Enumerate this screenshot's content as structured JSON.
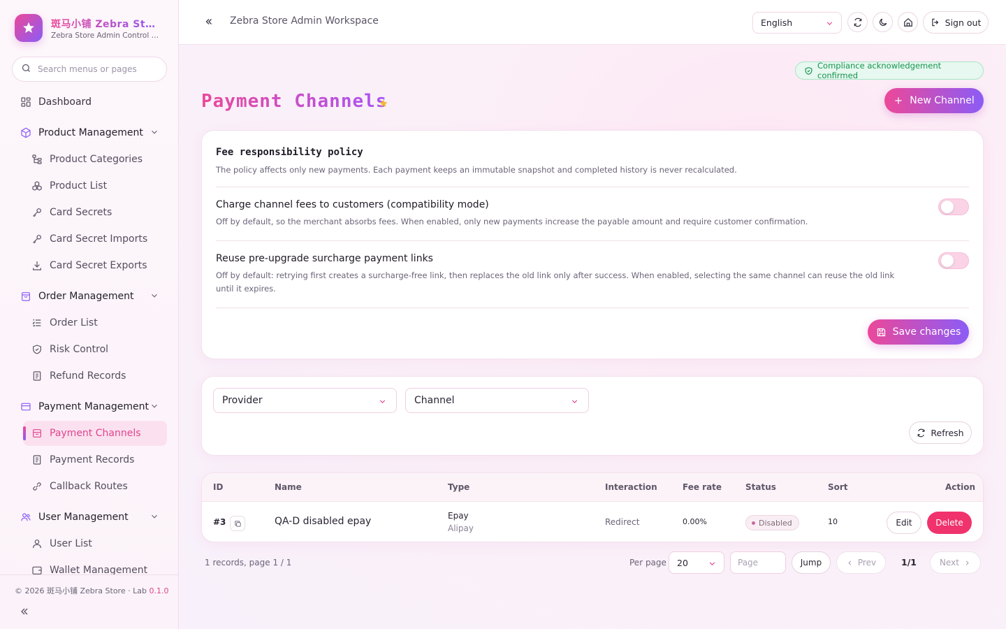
{
  "brand": {
    "title": "斑马小铺 Zebra St…",
    "subtitle": "Zebra Store Admin Control P…"
  },
  "sidebar": {
    "search_placeholder": "Search menus or pages",
    "dashboard": "Dashboard",
    "groups": {
      "product": "Product Management",
      "order": "Order Management",
      "payment": "Payment Management",
      "user": "User Management"
    },
    "items": {
      "product_categories": "Product Categories",
      "product_list": "Product List",
      "card_secrets": "Card Secrets",
      "card_secret_imports": "Card Secret Imports",
      "card_secret_exports": "Card Secret Exports",
      "order_list": "Order List",
      "risk_control": "Risk Control",
      "refund_records": "Refund Records",
      "payment_channels": "Payment Channels",
      "payment_records": "Payment Records",
      "callback_routes": "Callback Routes",
      "user_list": "User List",
      "wallet_management": "Wallet Management"
    },
    "footer": {
      "copyright": "© 2026 斑马小铺 Zebra Store · Lab ",
      "version": "0.1.0"
    }
  },
  "header": {
    "workspace_title": "Zebra Store Admin Workspace",
    "language": "English",
    "sign_out": "Sign out"
  },
  "page": {
    "compliance_badge": "Compliance acknowledgement confirmed",
    "title": "Payment Channels",
    "new_channel": "New Channel"
  },
  "fee_policy": {
    "title": "Fee responsibility policy",
    "description": "The policy affects only new payments. Each payment keeps an immutable snapshot and completed history is never recalculated.",
    "options": [
      {
        "title": "Charge channel fees to customers (compatibility mode)",
        "description": "Off by default, so the merchant absorbs fees. When enabled, only new payments increase the payable amount and require customer confirmation.",
        "enabled": false
      },
      {
        "title": "Reuse pre-upgrade surcharge payment links",
        "description": "Off by default: retrying first creates a surcharge-free link, then replaces the old link only after success. When enabled, selecting the same channel can reuse the old link until it expires.",
        "enabled": false
      }
    ],
    "save_label": "Save changes"
  },
  "filters": {
    "provider": "Provider",
    "channel": "Channel",
    "refresh": "Refresh"
  },
  "table": {
    "columns": [
      "ID",
      "Name",
      "Type",
      "Interaction",
      "Fee rate",
      "Status",
      "Sort",
      "Action"
    ],
    "rows": [
      {
        "id": "#3",
        "name": "QA-D disabled epay",
        "type": "Epay",
        "subtype": "Alipay",
        "interaction": "Redirect",
        "fee_rate": "0.00%",
        "status": "Disabled",
        "sort": "10",
        "edit": "Edit",
        "delete": "Delete"
      }
    ]
  },
  "pagination": {
    "summary": "1 records, page 1 / 1",
    "per_page_label": "Per page",
    "per_page_value": "20",
    "page_placeholder": "Page",
    "jump": "Jump",
    "prev": "Prev",
    "count": "1/1",
    "next": "Next"
  },
  "colors": {
    "accent_pink": "#ec4899",
    "accent_purple": "#8b5cf6",
    "danger": "#f0336c",
    "success": "#17944f"
  },
  "icons": [
    "sparkle-logo-icon",
    "search-icon",
    "grid-icon",
    "box-icon",
    "chevron-down-icon",
    "tree-icon",
    "cube-group-icon",
    "key-icon",
    "download-icon",
    "bag-icon",
    "list-icon",
    "shield-icon",
    "document-icon",
    "card-icon",
    "link-icon",
    "users-icon",
    "user-icon",
    "wallet-icon",
    "double-chevron-left-icon",
    "refresh-icon",
    "moon-icon",
    "home-icon",
    "logout-icon",
    "shield-check-icon",
    "star-icon",
    "plus-icon",
    "save-icon",
    "copy-icon",
    "chevron-left-icon",
    "chevron-right-icon"
  ]
}
